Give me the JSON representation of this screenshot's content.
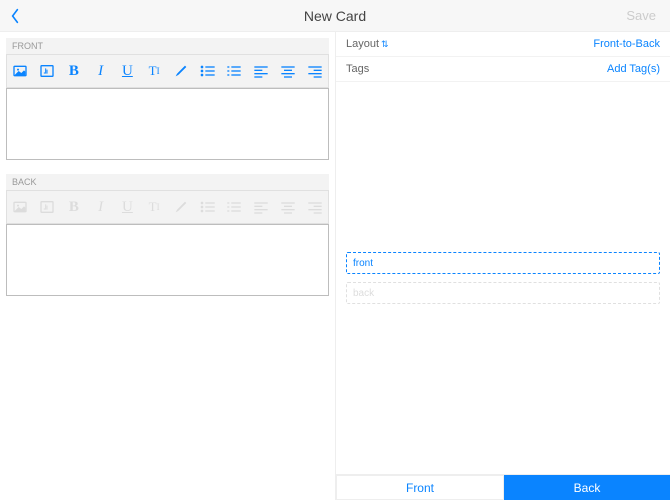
{
  "header": {
    "title": "New Card",
    "save": "Save"
  },
  "front": {
    "label": "FRONT"
  },
  "back": {
    "label": "BACK"
  },
  "layout": {
    "label": "Layout",
    "value": "Front-to-Back"
  },
  "tags": {
    "label": "Tags",
    "value": "Add Tag(s)"
  },
  "preview": {
    "front": "front",
    "back": "back"
  },
  "tabs": {
    "front": "Front",
    "back": "Back"
  },
  "toolbar": {
    "bold": "B",
    "italic": "I",
    "underline": "U",
    "textStyle": "T"
  }
}
